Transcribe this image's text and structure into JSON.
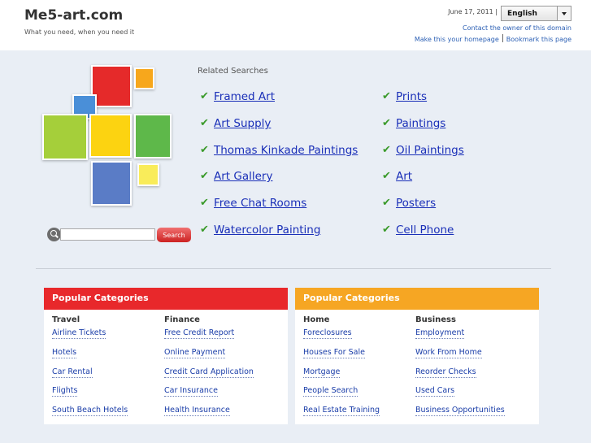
{
  "header": {
    "site_title": "Me5-art.com",
    "tagline": "What you need, when you need it",
    "date": "June 17, 2011 |",
    "language": "English",
    "contact_link": "Contact the owner of this domain",
    "homepage_link": "Make this your homepage",
    "bookmark_link": "Bookmark this page"
  },
  "logo_colors": [
    "#e52a2a",
    "#f7a71c",
    "#4a8fd8",
    "#a5cf3a",
    "#fcd311",
    "#5eb84a",
    "#5a7cc6",
    "#f9ec5a"
  ],
  "search": {
    "button_label": "Search",
    "placeholder": ""
  },
  "related": {
    "title": "Related Searches",
    "left": [
      "Framed Art",
      "Art Supply",
      "Thomas Kinkade Paintings",
      "Art Gallery",
      "Free Chat Rooms",
      "Watercolor Painting"
    ],
    "right": [
      "Prints",
      "Paintings",
      "Oil Paintings",
      "Art",
      "Posters",
      "Cell Phone"
    ],
    "check_color": "#3a9a2a"
  },
  "panels": [
    {
      "title": "Popular Categories",
      "color": "#e8282b",
      "columns": [
        {
          "title": "Travel",
          "links": [
            "Airline Tickets",
            "Hotels",
            "Car Rental",
            "Flights",
            "South Beach Hotels"
          ]
        },
        {
          "title": "Finance",
          "links": [
            "Free Credit Report",
            "Online Payment",
            "Credit Card Application",
            "Car Insurance",
            "Health Insurance"
          ]
        }
      ]
    },
    {
      "title": "Popular Categories",
      "color": "#f6a623",
      "columns": [
        {
          "title": "Home",
          "links": [
            "Foreclosures",
            "Houses For Sale",
            "Mortgage",
            "People Search",
            "Real Estate Training"
          ]
        },
        {
          "title": "Business",
          "links": [
            "Employment",
            "Work From Home",
            "Reorder Checks",
            "Used Cars",
            "Business Opportunities"
          ]
        }
      ]
    }
  ]
}
